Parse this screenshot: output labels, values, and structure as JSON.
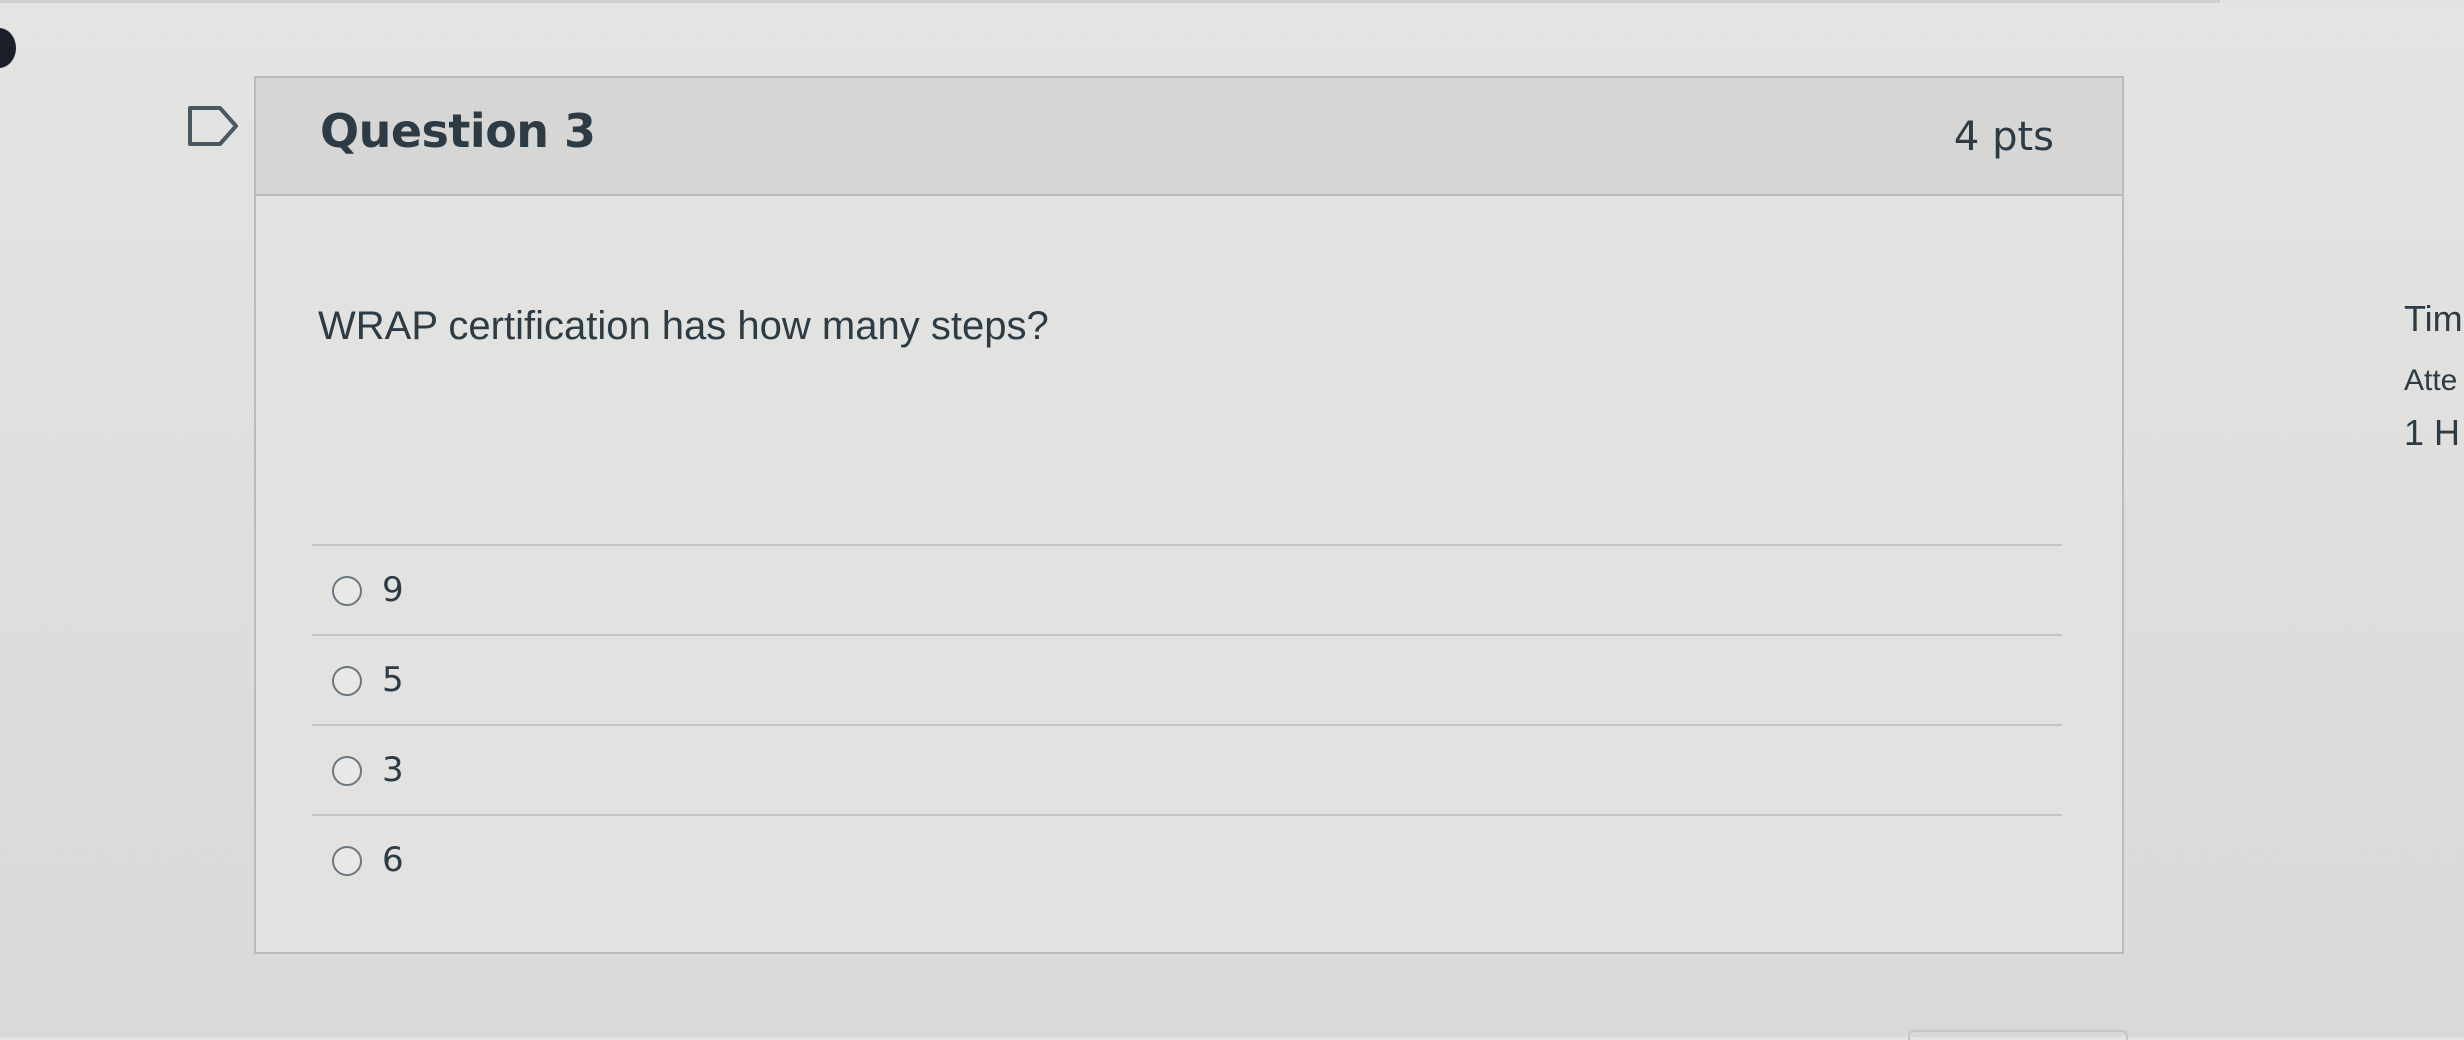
{
  "question": {
    "title": "Question 3",
    "points": "4 pts",
    "text": "WRAP certification has how many steps?",
    "flag_icon": "flag-question-icon",
    "answers": [
      {
        "label": "9",
        "selected": false
      },
      {
        "label": "5",
        "selected": false
      },
      {
        "label": "3",
        "selected": false
      },
      {
        "label": "6",
        "selected": false
      }
    ]
  },
  "sidebar": {
    "time_label": "Tim",
    "attempt_label": "Atte",
    "hours_value": "1 H"
  },
  "colors": {
    "text": "#2d3b45",
    "header_bg": "#d6d7d5",
    "card_border": "#b9bbbd"
  }
}
